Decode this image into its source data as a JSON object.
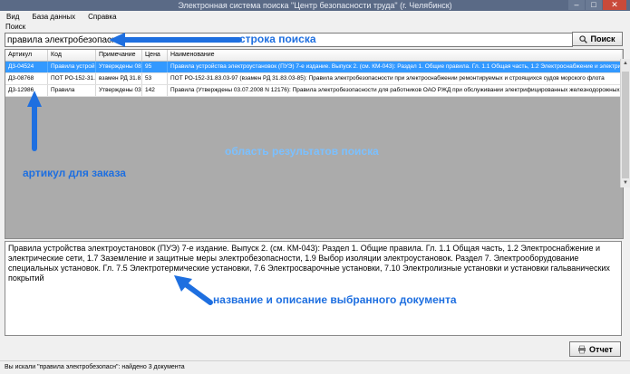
{
  "window": {
    "title": "Электронная система поиска \"Центр безопасности труда\" (г. Челябинск)"
  },
  "menu": {
    "items": [
      {
        "label": "Вид"
      },
      {
        "label": "База данных"
      },
      {
        "label": "Справка"
      }
    ]
  },
  "search": {
    "label": "Поиск",
    "value": "правила электробезопасн",
    "button_label": "Поиск"
  },
  "grid": {
    "columns": [
      "Артикул",
      "Код",
      "Примечание",
      "Цена",
      "Наименование"
    ],
    "rows": [
      {
        "article": "Д3-04524",
        "code": "Правила устрой...",
        "note": "Утверждены 08...",
        "price": "95",
        "name": "Правила устройства электроустановок (ПУЭ) 7-е издание. Выпуск 2. (см. КМ-043): Раздел 1. Общие правила. Гл. 1.1 Общая часть, 1.2 Электроснабжение и электрические сети, 1.7"
      },
      {
        "article": "Д3-08768",
        "code": "ПОТ РО-152-31...",
        "note": "взамен РД 31.8...",
        "price": "53",
        "name": "ПОТ РО-152-31.83.03-97 (взамен РД 31.83.03-85): Правила электробезопасности при электроснабжении ремонтируемых и строящихся судов морского флота"
      },
      {
        "article": "Д3-12986",
        "code": "Правила",
        "note": "Утверждены 03.0...",
        "price": "142",
        "name": "Правила (Утверждены 03.07.2008 N 12176): Правила электробезопасности для работников ОАО РЖД при обслуживании электрифицированных железнодорожных путей"
      }
    ]
  },
  "description": {
    "text": "Правила устройства электроустановок (ПУЭ) 7-е издание. Выпуск 2. (см. КМ-043): Раздел 1. Общие правила. Гл. 1.1 Общая часть, 1.2 Электроснабжение и электрические сети, 1.7 Заземление и защитные меры электробезопасности, 1.9 Выбор изоляции электроустановок. Раздел 7. Электрооборудование специальных установок. Гл. 7.5 Электротермические установки, 7.6 Электросварочные установки, 7.10 Электролизные установки и установки гальванических покрытий"
  },
  "report": {
    "button_label": "Отчет"
  },
  "status": {
    "text": "Вы искали \"правила электробезопасн\": найдено 3 документа"
  },
  "annotations": {
    "search_line": "строка поиска",
    "results_area": "область результатов поиска",
    "article_for_order": "артикул для заказа",
    "document_desc": "название и описание выбранного документа"
  },
  "colors": {
    "annotation": "#1e6fe0",
    "selection": "#3399ff",
    "grid_bg": "#ababab"
  },
  "icons": {
    "search": "magnifier-icon",
    "report": "report-icon"
  }
}
